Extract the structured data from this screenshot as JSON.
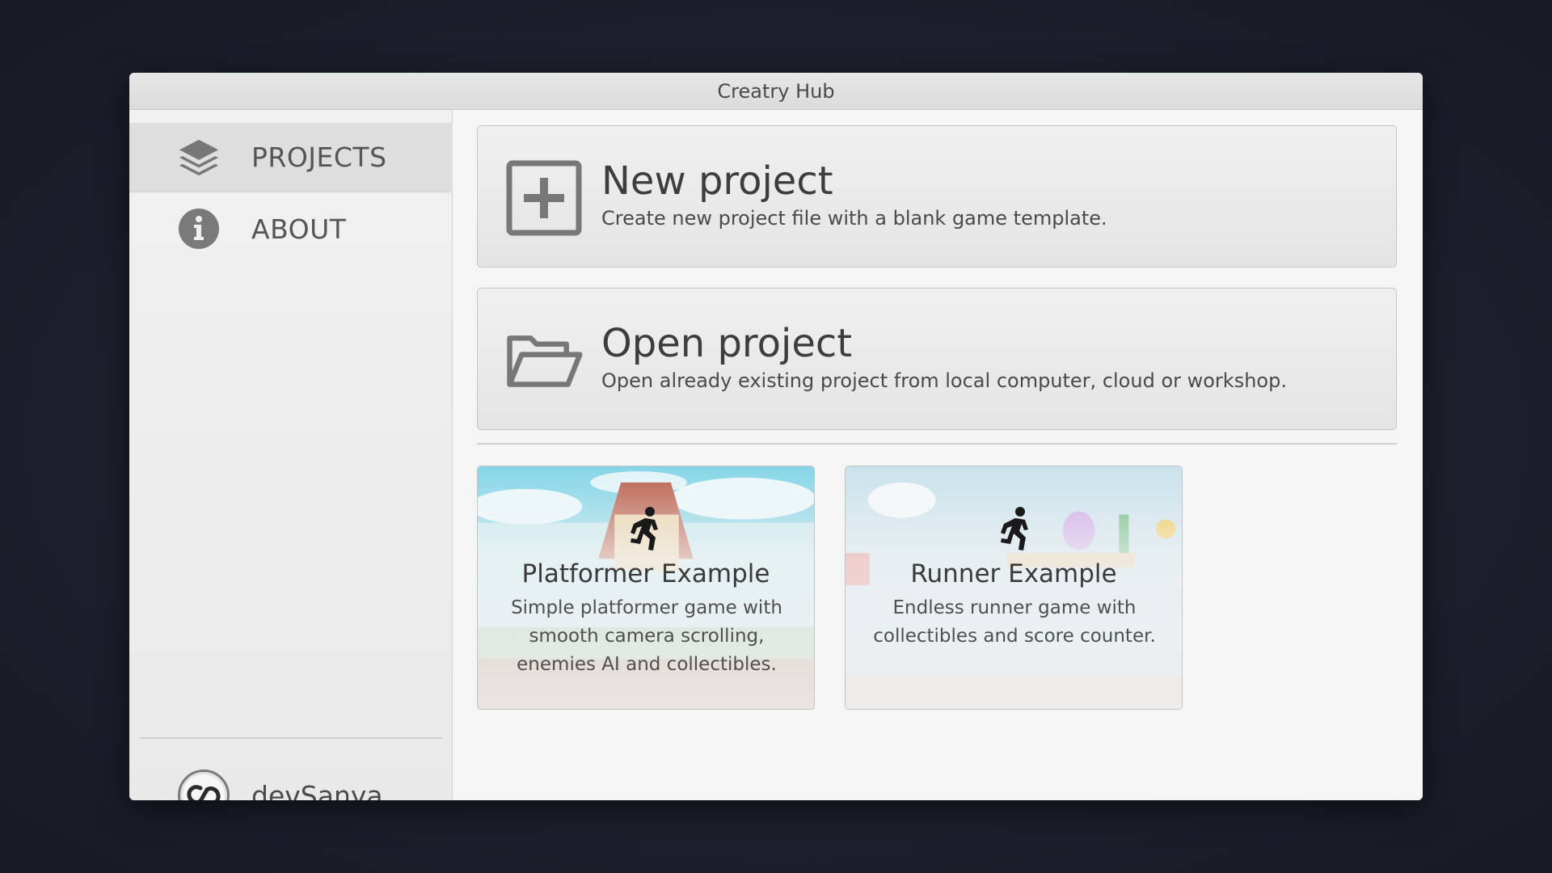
{
  "window": {
    "title": "Creatry Hub"
  },
  "sidebar": {
    "items": [
      {
        "label": "PROJECTS",
        "icon": "layers-icon",
        "active": true
      },
      {
        "label": "ABOUT",
        "icon": "info-icon",
        "active": false
      }
    ],
    "user": {
      "name": "devSanya",
      "icon": "user-avatar"
    }
  },
  "actions": {
    "new_project": {
      "title": "New project",
      "description": "Create new project file with a blank game template.",
      "icon": "plus-square-icon"
    },
    "open_project": {
      "title": "Open project",
      "description": "Open already existing project from local computer, cloud or workshop.",
      "icon": "folder-open-icon"
    }
  },
  "examples": [
    {
      "title": "Platformer Example",
      "description": "Simple platformer game with smooth camera scrolling, enemies AI and collectibles.",
      "icon": "running-person-icon"
    },
    {
      "title": "Runner Example",
      "description": "Endless runner game with collectibles and score counter.",
      "icon": "running-person-icon"
    }
  ],
  "colors": {
    "background": "#1b1f2b",
    "window": "#f4f4f4",
    "sidebar_active": "#dedede",
    "icon_gray": "#777777",
    "text_dark": "#3d3d3d"
  }
}
